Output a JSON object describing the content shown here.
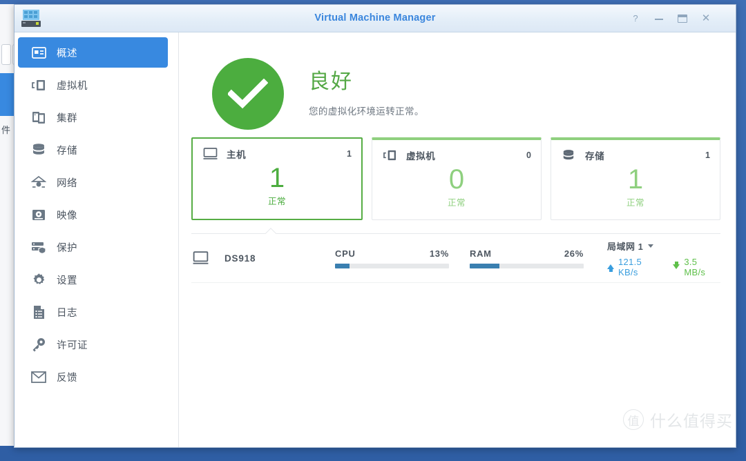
{
  "window": {
    "title": "Virtual Machine Manager",
    "app_icon": "server-rack-icon",
    "controls": {
      "help": "?",
      "minimize": "minimize-icon",
      "maximize": "maximize-icon",
      "close": "✕"
    }
  },
  "desktop": {
    "partial_text": "件"
  },
  "sidebar": {
    "items": [
      {
        "label": "概述",
        "icon": "overview-card-icon",
        "active": true
      },
      {
        "label": "虚拟机",
        "icon": "virtual-machine-icon",
        "active": false
      },
      {
        "label": "集群",
        "icon": "cluster-icon",
        "active": false
      },
      {
        "label": "存储",
        "icon": "storage-disks-icon",
        "active": false
      },
      {
        "label": "网络",
        "icon": "network-icon",
        "active": false
      },
      {
        "label": "映像",
        "icon": "image-disc-icon",
        "active": false
      },
      {
        "label": "保护",
        "icon": "protection-shield-icon",
        "active": false
      },
      {
        "label": "设置",
        "icon": "gear-icon",
        "active": false
      },
      {
        "label": "日志",
        "icon": "log-document-icon",
        "active": false
      },
      {
        "label": "许可证",
        "icon": "key-icon",
        "active": false
      },
      {
        "label": "反馈",
        "icon": "envelope-icon",
        "active": false
      }
    ]
  },
  "health": {
    "icon": "check-circle-icon",
    "title": "良好",
    "subtitle": "您的虚拟化环境运转正常。",
    "color": "#4cad3f"
  },
  "cards": [
    {
      "title": "主机",
      "icon": "monitor-icon",
      "count": "1",
      "big": "1",
      "state": "正常",
      "selected": true
    },
    {
      "title": "虚拟机",
      "icon": "virtual-machine-icon",
      "count": "0",
      "big": "0",
      "state": "正常",
      "selected": false
    },
    {
      "title": "存储",
      "icon": "storage-disks-icon",
      "count": "1",
      "big": "1",
      "state": "正常",
      "selected": false
    }
  ],
  "host": {
    "icon": "monitor-icon",
    "name": "DS918",
    "cpu": {
      "label": "CPU",
      "value": "13%",
      "percent": 13
    },
    "ram": {
      "label": "RAM",
      "value": "26%",
      "percent": 26
    },
    "network": {
      "interface": "局域网 1",
      "upload": "121.5 KB/s",
      "download": "3.5 MB/s",
      "upload_color": "#3a9ede",
      "download_color": "#5fc04a"
    }
  },
  "watermark": {
    "mark": "值",
    "text": "什么值得买"
  }
}
